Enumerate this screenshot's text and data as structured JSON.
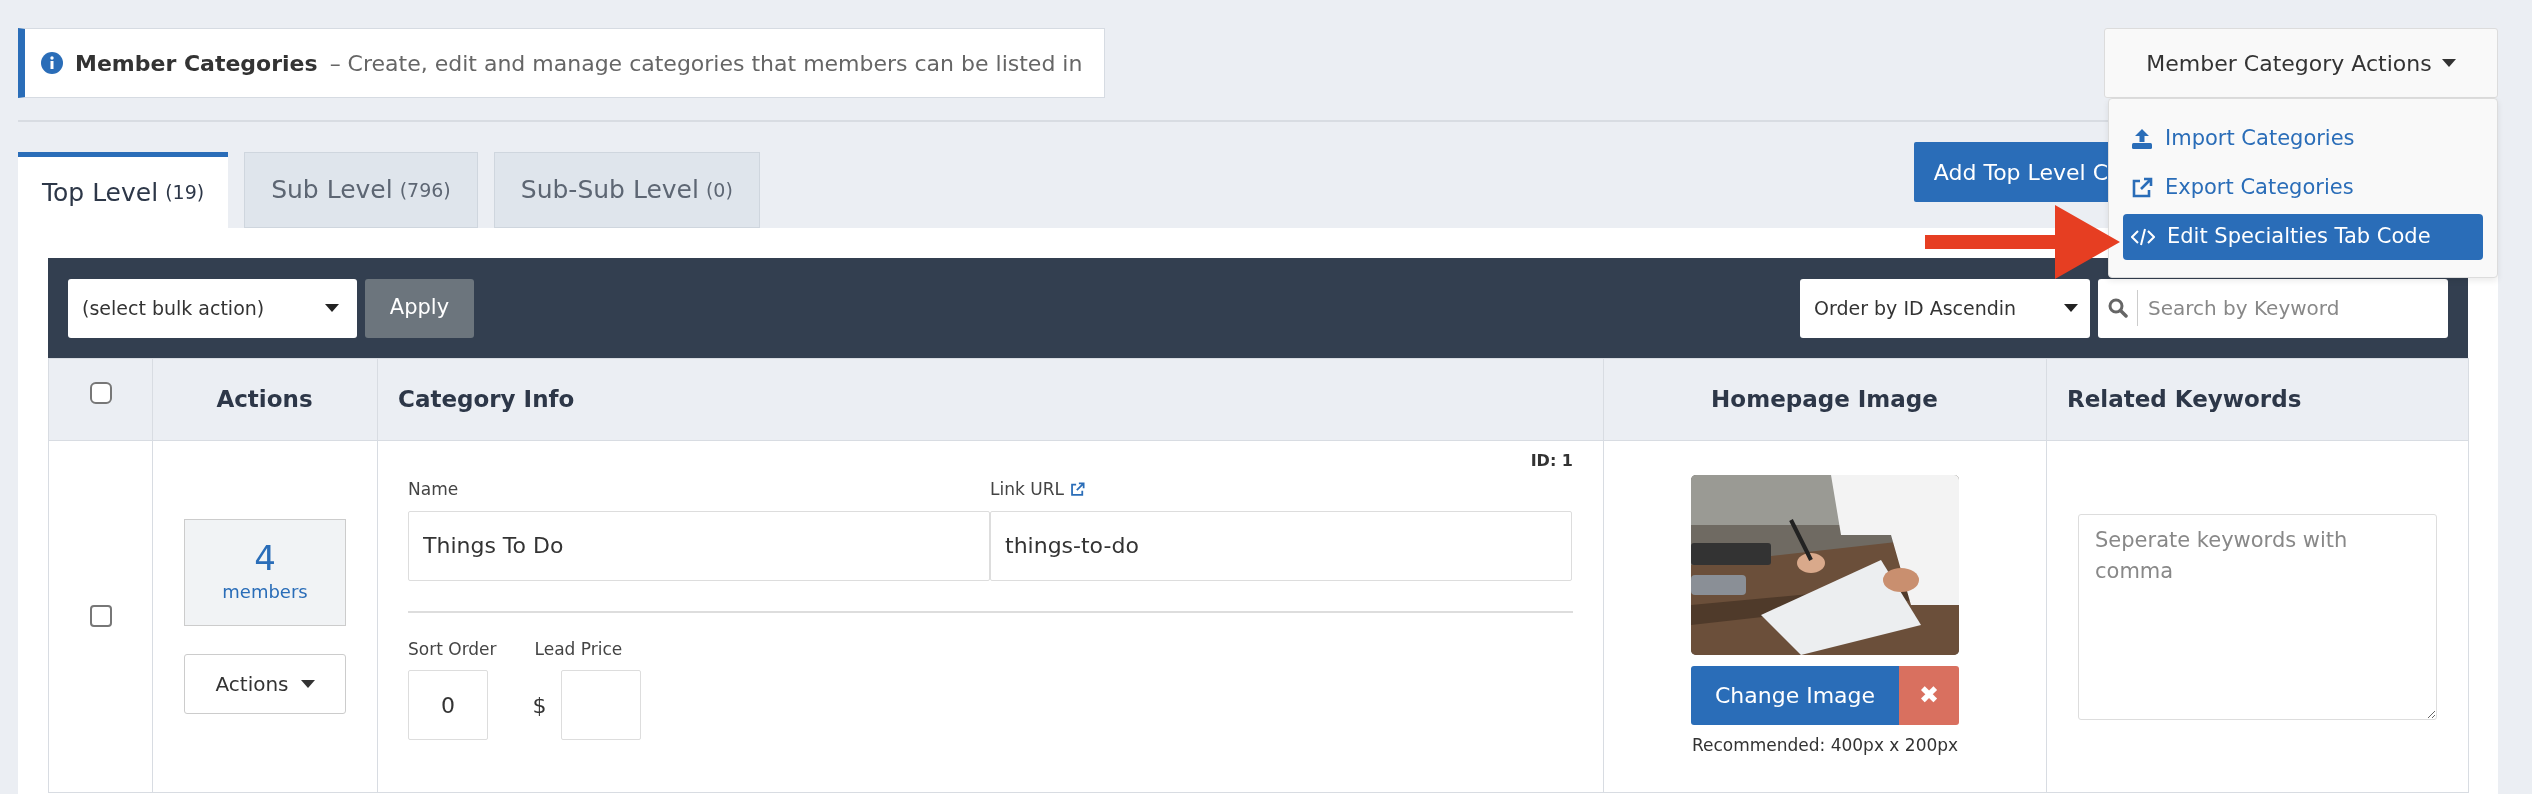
{
  "info_banner": {
    "title": "Member Categories",
    "description": "– Create, edit and manage categories that members can be listed in"
  },
  "actions_menu": {
    "label": "Member Category Actions",
    "expanded": true,
    "items": [
      {
        "kind": "import",
        "label": "Import Categories",
        "selected": false
      },
      {
        "kind": "export",
        "label": "Export Categories",
        "selected": false
      },
      {
        "kind": "code",
        "label": "Edit Specialties Tab Code",
        "selected": true
      }
    ]
  },
  "add_button": "Add Top Level C",
  "tabs": [
    {
      "label": "Top Level",
      "count": "(19)",
      "selected": true
    },
    {
      "label": "Sub Level",
      "count": "(796)",
      "selected": false
    },
    {
      "label": "Sub-Sub Level",
      "count": "(0)",
      "selected": false
    }
  ],
  "toolbar": {
    "bulk_action": "(select bulk action)",
    "apply": "Apply",
    "order": "Order by ID Ascendin",
    "search_placeholder": "Search by Keyword"
  },
  "table": {
    "select_all_checked": false,
    "columns": [
      "Actions",
      "Category Info",
      "Homepage Image",
      "Related Keywords"
    ],
    "rows": [
      {
        "checked": false,
        "member_count": "4",
        "member_label": "members",
        "actions": "Actions",
        "id": "ID: 1",
        "name_label": "Name",
        "name": "Things To Do",
        "url_label": "Link URL",
        "url": "things-to-do",
        "sort_label": "Sort Order",
        "sort_order": "0",
        "currency": "$",
        "price_label": "Lead Price",
        "lead_price": "",
        "change_image": "Change Image",
        "remove": "✖",
        "recommended": "Recommended: 400px x 200px",
        "keywords_placeholder": "Seperate keywords with comma"
      }
    ]
  }
}
